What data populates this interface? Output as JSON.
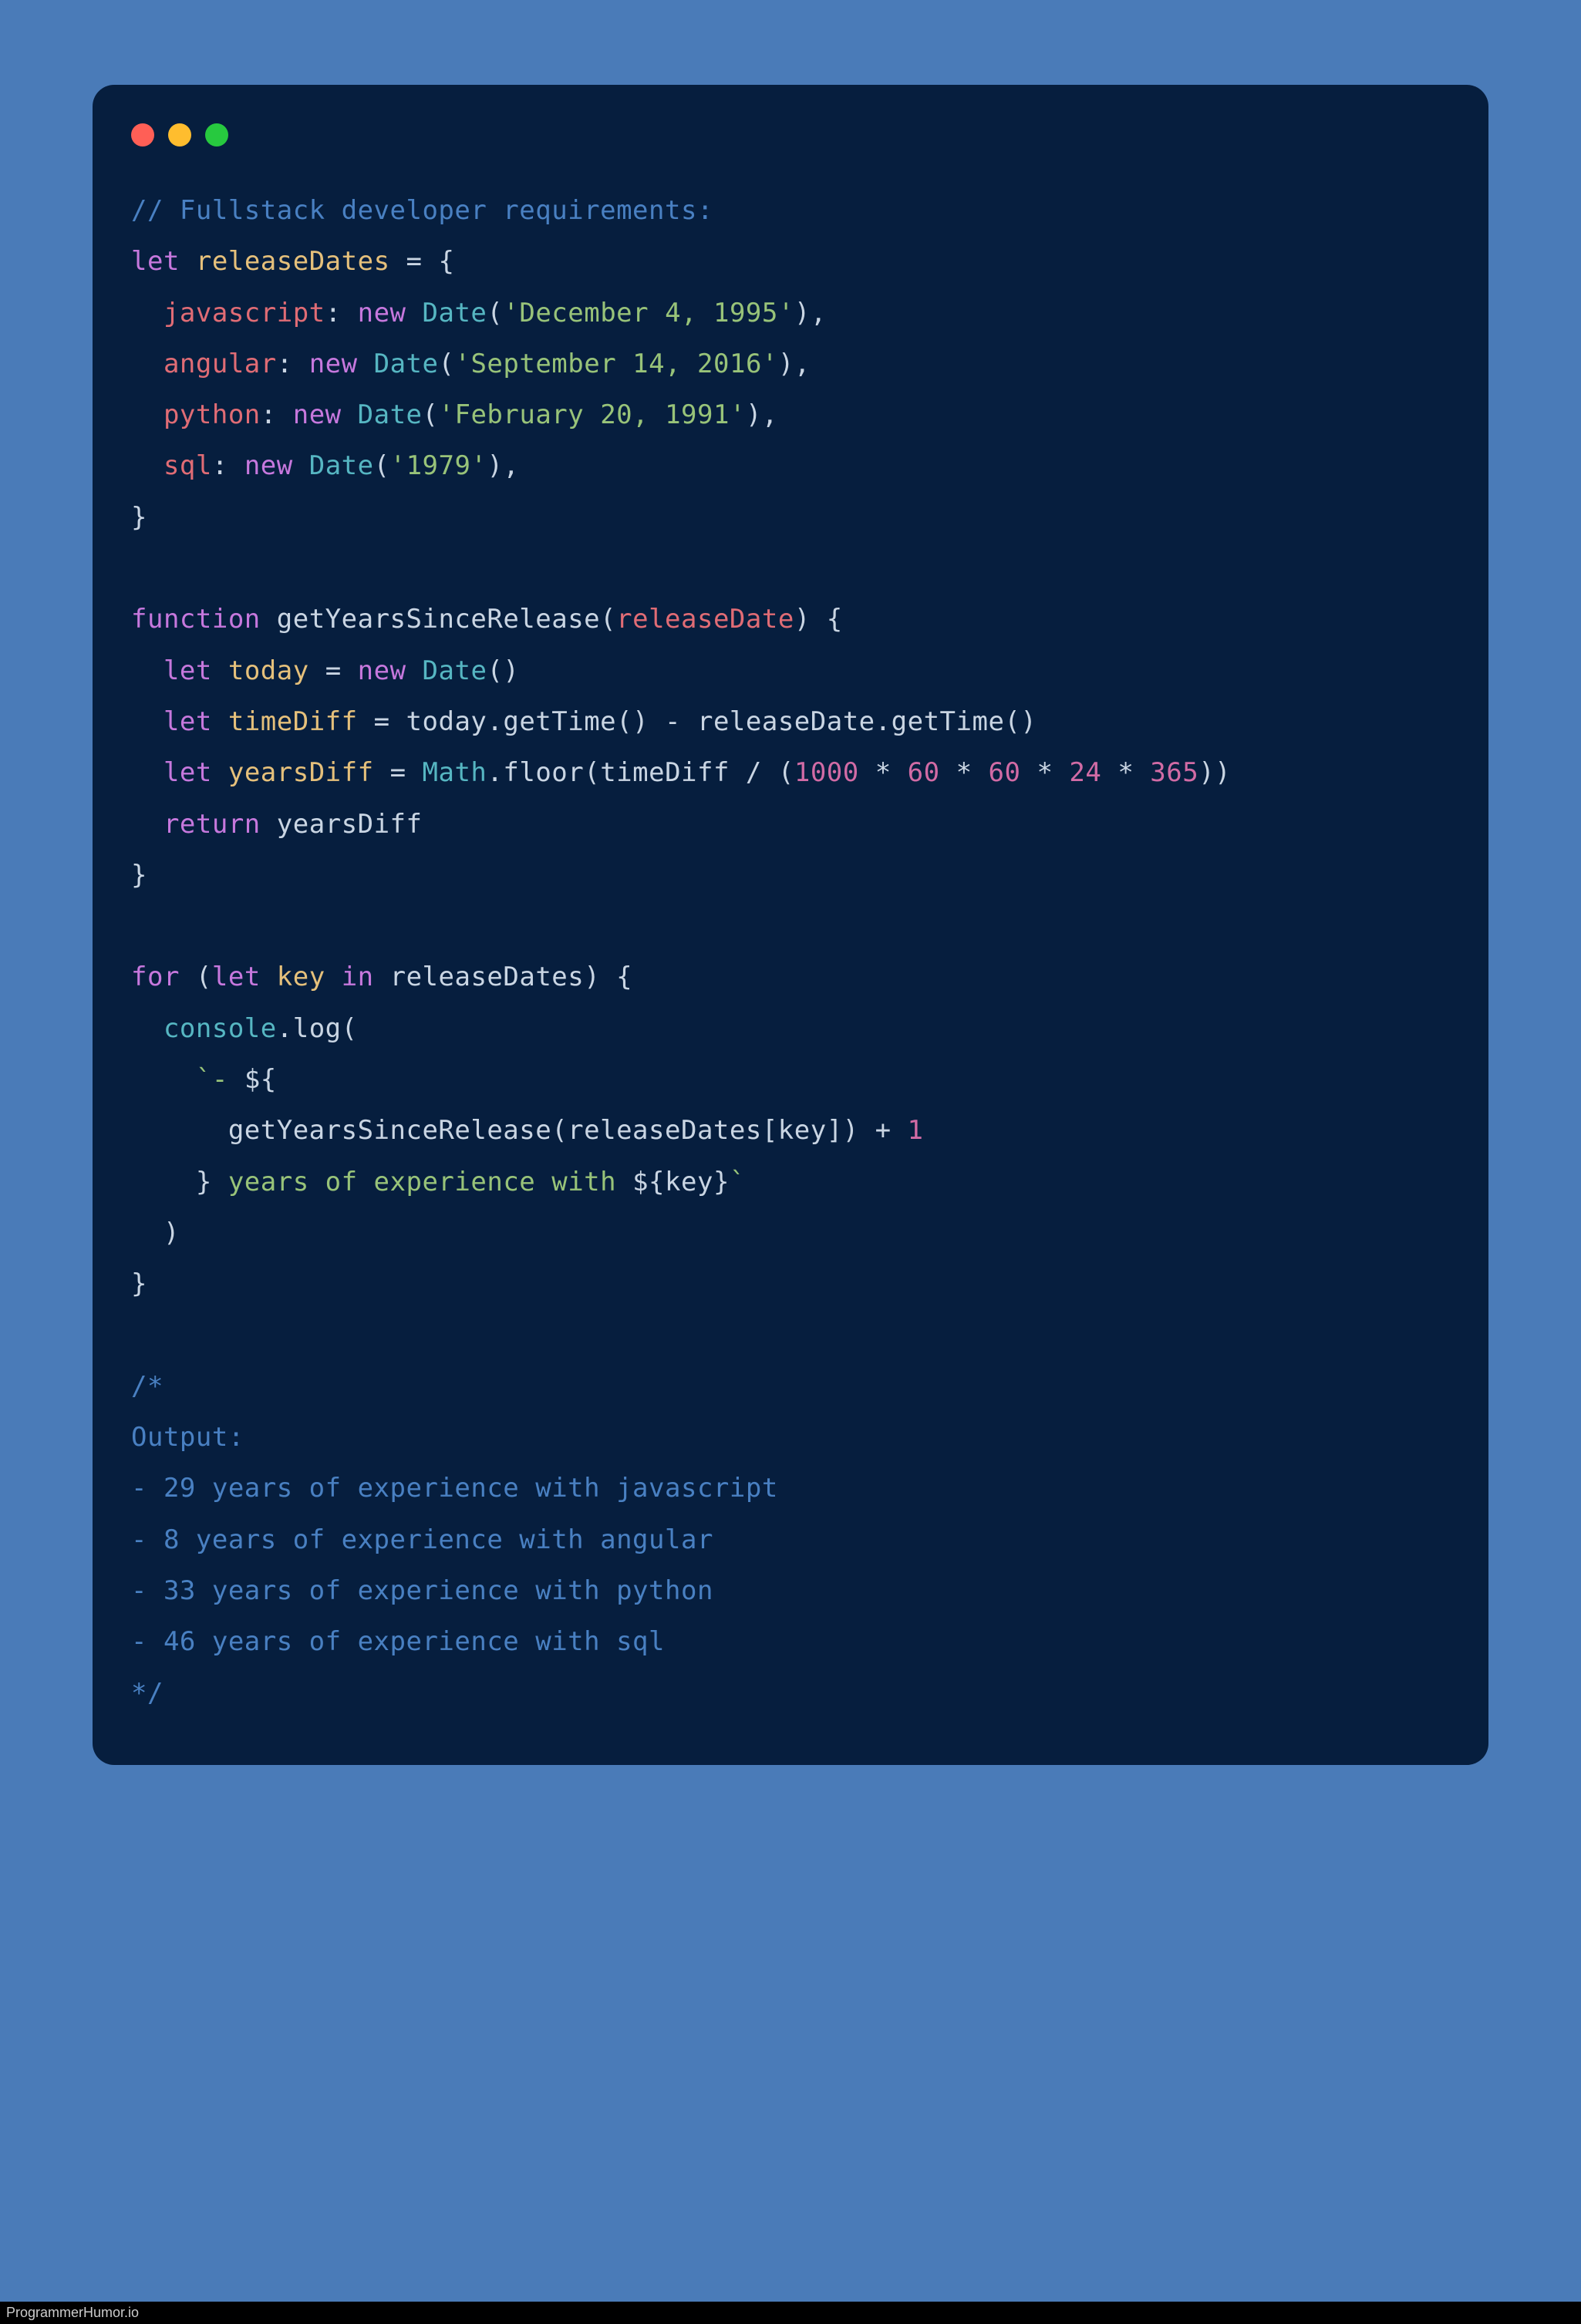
{
  "colors": {
    "bg": "#4a7bb8",
    "window": "#061e3e",
    "dotRed": "#ff5f56",
    "dotYellow": "#ffbd2e",
    "dotGreen": "#27c93f",
    "comment": "#4980c2",
    "keyword": "#c678dd",
    "prop": "#e06c75",
    "class": "#56b6c2",
    "string": "#98c379",
    "number": "#d16ba5",
    "text": "#c9d5e3"
  },
  "footer": "ProgrammerHumor.io",
  "code": {
    "lines": [
      [
        {
          "t": "// Fullstack developer requirements:",
          "c": "tk-comment"
        }
      ],
      [
        {
          "t": "let",
          "c": "tk-keyword"
        },
        {
          "t": " "
        },
        {
          "t": "releaseDates",
          "c": "tk-var"
        },
        {
          "t": " = {"
        }
      ],
      [
        {
          "t": "  "
        },
        {
          "t": "javascript",
          "c": "tk-prop"
        },
        {
          "t": ": "
        },
        {
          "t": "new",
          "c": "tk-new"
        },
        {
          "t": " "
        },
        {
          "t": "Date",
          "c": "tk-class"
        },
        {
          "t": "("
        },
        {
          "t": "'December 4, 1995'",
          "c": "tk-str"
        },
        {
          "t": "),"
        }
      ],
      [
        {
          "t": "  "
        },
        {
          "t": "angular",
          "c": "tk-prop"
        },
        {
          "t": ": "
        },
        {
          "t": "new",
          "c": "tk-new"
        },
        {
          "t": " "
        },
        {
          "t": "Date",
          "c": "tk-class"
        },
        {
          "t": "("
        },
        {
          "t": "'September 14, 2016'",
          "c": "tk-str"
        },
        {
          "t": "),"
        }
      ],
      [
        {
          "t": "  "
        },
        {
          "t": "python",
          "c": "tk-prop"
        },
        {
          "t": ": "
        },
        {
          "t": "new",
          "c": "tk-new"
        },
        {
          "t": " "
        },
        {
          "t": "Date",
          "c": "tk-class"
        },
        {
          "t": "("
        },
        {
          "t": "'February 20, 1991'",
          "c": "tk-str"
        },
        {
          "t": "),"
        }
      ],
      [
        {
          "t": "  "
        },
        {
          "t": "sql",
          "c": "tk-prop"
        },
        {
          "t": ": "
        },
        {
          "t": "new",
          "c": "tk-new"
        },
        {
          "t": " "
        },
        {
          "t": "Date",
          "c": "tk-class"
        },
        {
          "t": "("
        },
        {
          "t": "'1979'",
          "c": "tk-str"
        },
        {
          "t": "),"
        }
      ],
      [
        {
          "t": "}"
        }
      ],
      [
        {
          "t": ""
        }
      ],
      [
        {
          "t": "function",
          "c": "tk-keyword"
        },
        {
          "t": " "
        },
        {
          "t": "getYearsSinceRelease",
          "c": "tk-fnname"
        },
        {
          "t": "("
        },
        {
          "t": "releaseDate",
          "c": "tk-param"
        },
        {
          "t": ") {"
        }
      ],
      [
        {
          "t": "  "
        },
        {
          "t": "let",
          "c": "tk-keyword"
        },
        {
          "t": " "
        },
        {
          "t": "today",
          "c": "tk-var"
        },
        {
          "t": " = "
        },
        {
          "t": "new",
          "c": "tk-new"
        },
        {
          "t": " "
        },
        {
          "t": "Date",
          "c": "tk-class"
        },
        {
          "t": "()"
        }
      ],
      [
        {
          "t": "  "
        },
        {
          "t": "let",
          "c": "tk-keyword"
        },
        {
          "t": " "
        },
        {
          "t": "timeDiff",
          "c": "tk-var"
        },
        {
          "t": " = today.getTime() - releaseDate.getTime()"
        }
      ],
      [
        {
          "t": "  "
        },
        {
          "t": "let",
          "c": "tk-keyword"
        },
        {
          "t": " "
        },
        {
          "t": "yearsDiff",
          "c": "tk-var"
        },
        {
          "t": " = "
        },
        {
          "t": "Math",
          "c": "tk-class"
        },
        {
          "t": ".floor(timeDiff / ("
        },
        {
          "t": "1000",
          "c": "tk-num"
        },
        {
          "t": " * "
        },
        {
          "t": "60",
          "c": "tk-num"
        },
        {
          "t": " * "
        },
        {
          "t": "60",
          "c": "tk-num"
        },
        {
          "t": " * "
        },
        {
          "t": "24",
          "c": "tk-num"
        },
        {
          "t": " * "
        },
        {
          "t": "365",
          "c": "tk-num"
        },
        {
          "t": "))"
        }
      ],
      [
        {
          "t": "  "
        },
        {
          "t": "return",
          "c": "tk-return"
        },
        {
          "t": " yearsDiff"
        }
      ],
      [
        {
          "t": "}"
        }
      ],
      [
        {
          "t": ""
        }
      ],
      [
        {
          "t": "for",
          "c": "tk-keyword"
        },
        {
          "t": " ("
        },
        {
          "t": "let",
          "c": "tk-keyword"
        },
        {
          "t": " "
        },
        {
          "t": "key",
          "c": "tk-var"
        },
        {
          "t": " "
        },
        {
          "t": "in",
          "c": "tk-keyword"
        },
        {
          "t": " releaseDates) {"
        }
      ],
      [
        {
          "t": "  "
        },
        {
          "t": "console",
          "c": "tk-console"
        },
        {
          "t": ".log("
        }
      ],
      [
        {
          "t": "    "
        },
        {
          "t": "`- ",
          "c": "tk-tmpl"
        },
        {
          "t": "${"
        }
      ],
      [
        {
          "t": "      getYearsSinceRelease(releaseDates[key]) + "
        },
        {
          "t": "1",
          "c": "tk-num"
        }
      ],
      [
        {
          "t": "    }"
        },
        {
          "t": " years of experience with ",
          "c": "tk-tmpl"
        },
        {
          "t": "${"
        },
        {
          "t": "key"
        },
        {
          "t": "}"
        },
        {
          "t": "`",
          "c": "tk-tmpl"
        }
      ],
      [
        {
          "t": "  )"
        }
      ],
      [
        {
          "t": "}"
        }
      ],
      [
        {
          "t": ""
        }
      ],
      [
        {
          "t": "/*",
          "c": "tk-comment"
        }
      ],
      [
        {
          "t": "Output:",
          "c": "tk-comment"
        }
      ],
      [
        {
          "t": "- 29 years of experience with javascript",
          "c": "tk-comment"
        }
      ],
      [
        {
          "t": "- 8 years of experience with angular",
          "c": "tk-comment"
        }
      ],
      [
        {
          "t": "- 33 years of experience with python",
          "c": "tk-comment"
        }
      ],
      [
        {
          "t": "- 46 years of experience with sql",
          "c": "tk-comment"
        }
      ],
      [
        {
          "t": "*/",
          "c": "tk-comment"
        }
      ]
    ]
  }
}
